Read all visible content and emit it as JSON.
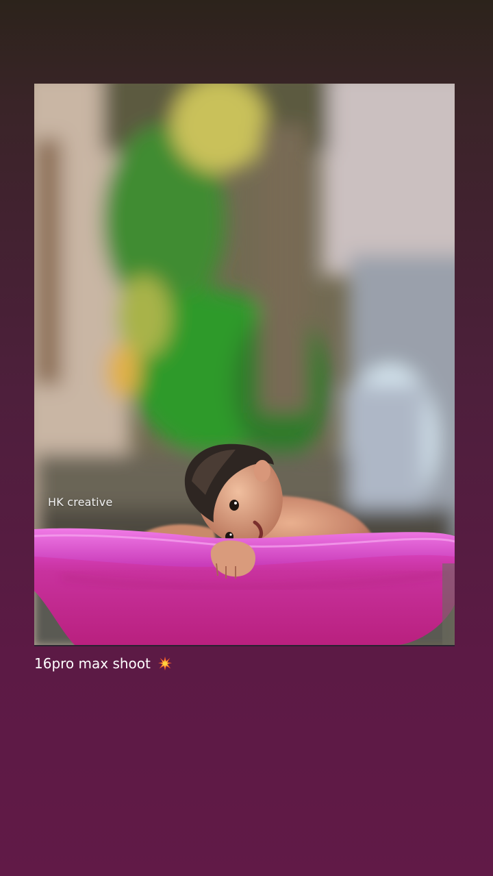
{
  "photo": {
    "watermark": "HK creative",
    "subject": "child-in-pink-tub"
  },
  "caption": {
    "text": "16pro max shoot",
    "icon": "collision-spark-icon"
  },
  "colors": {
    "background_top": "#2c231b",
    "background_bottom": "#611a47",
    "tub_pink": "#d63aa8",
    "foliage_green": "#2f8a2a"
  }
}
